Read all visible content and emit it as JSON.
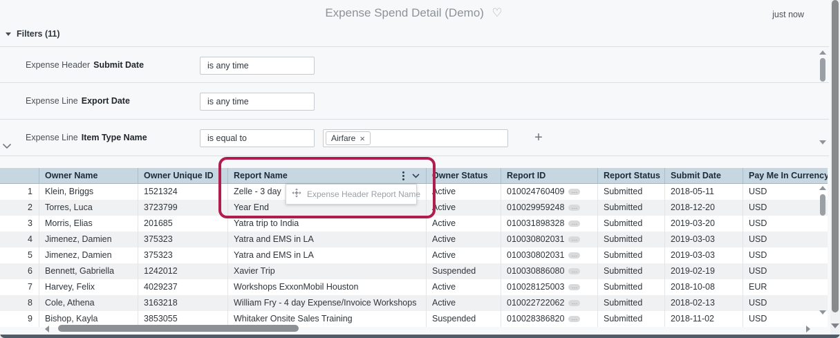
{
  "page": {
    "title": "Expense Spend Detail (Demo)",
    "updated_badge": "just now"
  },
  "icons": {
    "heart": "♡",
    "plus": "+",
    "times": "×",
    "ellipsis": "…"
  },
  "filters": {
    "header_label": "Filters (11)",
    "rows": [
      {
        "entity": "Expense Header",
        "field": "Submit Date",
        "condition": "is any time"
      },
      {
        "entity": "Expense Line",
        "field": "Export Date",
        "condition": "is any time"
      },
      {
        "entity": "Expense Line",
        "field": "Item Type Name",
        "condition": "is equal to",
        "value": "Airfare"
      }
    ]
  },
  "drag_tooltip": {
    "label": "Expense Header Report Name"
  },
  "table": {
    "columns": {
      "row_num": "",
      "owner_name": "Owner Name",
      "owner_unique_id": "Owner Unique ID",
      "report_name": "Report Name",
      "owner_status": "Owner Status",
      "report_id": "Report ID",
      "report_status": "Report Status",
      "submit_date": "Submit Date",
      "pay_me_in_currency": "Pay Me In Currency C"
    },
    "rows": [
      {
        "num": "1",
        "owner": "Klein, Briggs",
        "uid": "1521324",
        "report": "Zelle - 3 day",
        "owner_status": "Active",
        "report_id": "010024760409",
        "report_status": "Submitted",
        "submit_date": "2018-05-11",
        "currency": "USD"
      },
      {
        "num": "2",
        "owner": "Torres, Luca",
        "uid": "3723799",
        "report": "Year End",
        "owner_status": "Active",
        "report_id": "010029959248",
        "report_status": "Submitted",
        "submit_date": "2018-12-20",
        "currency": "USD"
      },
      {
        "num": "3",
        "owner": "Morris, Elias",
        "uid": "201685",
        "report": "Yatra trip to India",
        "owner_status": "Active",
        "report_id": "010031898328",
        "report_status": "Submitted",
        "submit_date": "2019-03-20",
        "currency": "USD"
      },
      {
        "num": "4",
        "owner": "Jimenez, Damien",
        "uid": "375323",
        "report": "Yatra and EMS in LA",
        "owner_status": "Active",
        "report_id": "010030802031",
        "report_status": "Submitted",
        "submit_date": "2019-03-03",
        "currency": "USD"
      },
      {
        "num": "5",
        "owner": "Jimenez, Damien",
        "uid": "375323",
        "report": "Yatra and EMS in LA",
        "owner_status": "Active",
        "report_id": "010030802031",
        "report_status": "Submitted",
        "submit_date": "2019-03-03",
        "currency": "USD"
      },
      {
        "num": "6",
        "owner": "Bennett, Gabriella",
        "uid": "1242012",
        "report": "Xavier Trip",
        "owner_status": "Suspended",
        "report_id": "010030886080",
        "report_status": "Submitted",
        "submit_date": "2019-02-19",
        "currency": "USD"
      },
      {
        "num": "7",
        "owner": "Harvey, Felix",
        "uid": "4029237",
        "report": "Workshops ExxonMobil Houston",
        "owner_status": "Active",
        "report_id": "010028125003",
        "report_status": "Submitted",
        "submit_date": "2018-10-08",
        "currency": "EUR"
      },
      {
        "num": "8",
        "owner": "Cole, Athena",
        "uid": "3163218",
        "report": "William Fry - 4 day Expense/Invoice Workshops",
        "owner_status": "Active",
        "report_id": "010022722062",
        "report_status": "Submitted",
        "submit_date": "2018-02-13",
        "currency": "USD"
      },
      {
        "num": "9",
        "owner": "Bishop, Kayla",
        "uid": "3853055",
        "report": "Whitaker Onsite Sales Training",
        "owner_status": "Suspended",
        "report_id": "010028386820",
        "report_status": "Submitted",
        "submit_date": "2018-11-02",
        "currency": "USD"
      }
    ]
  },
  "colors": {
    "annotation_red": "#b01e4e",
    "table_header_bg": "#c6d7e2",
    "row_alt_bg": "#f0f1f2"
  }
}
